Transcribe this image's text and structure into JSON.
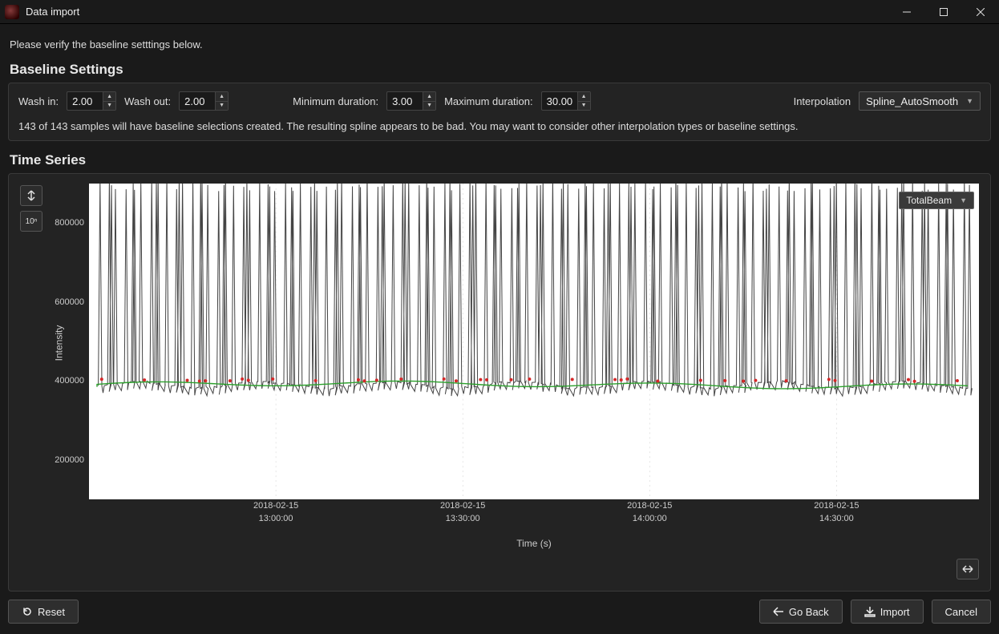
{
  "window": {
    "title": "Data import"
  },
  "instruction": "Please verify the baseline setttings below.",
  "baseline": {
    "heading": "Baseline Settings",
    "wash_in_label": "Wash in:",
    "wash_in_value": "2.00",
    "wash_out_label": "Wash out:",
    "wash_out_value": "2.00",
    "min_dur_label": "Minimum duration:",
    "min_dur_value": "3.00",
    "max_dur_label": "Maximum duration:",
    "max_dur_value": "30.00",
    "interp_label": "Interpolation",
    "interp_value": "Spline_AutoSmooth",
    "status": "143 of 143 samples will have baseline selections created. The resulting spline appears to be bad. You may want to consider other interpolation types or baseline settings."
  },
  "timeseries": {
    "heading": "Time Series",
    "ylabel": "Intensity",
    "xlabel": "Time (s)",
    "series_selected": "TotalBeam",
    "log_btn": "10ⁿ",
    "y_ticks": [
      "200000",
      "400000",
      "600000",
      "800000"
    ],
    "x_ticks": [
      {
        "pos": 0.21,
        "line1": "2018-02-15",
        "line2": "13:00:00"
      },
      {
        "pos": 0.42,
        "line1": "2018-02-15",
        "line2": "13:30:00"
      },
      {
        "pos": 0.63,
        "line1": "2018-02-15",
        "line2": "14:00:00"
      },
      {
        "pos": 0.84,
        "line1": "2018-02-15",
        "line2": "14:30:00"
      }
    ]
  },
  "chart_data": {
    "type": "line",
    "title": "",
    "xlabel": "Time (s)",
    "ylabel": "Intensity",
    "ylim": [
      100000,
      900000
    ],
    "series": [
      {
        "name": "TotalBeam",
        "description": "rapid intensity spikes to >900000 over a ~390000 baseline, ~143 peaks between 2018-02-15 12:45 and 14:45"
      },
      {
        "name": "baseline_spline",
        "description": "green spline fit near 380000–400000"
      },
      {
        "name": "markers",
        "description": "red baseline selection markers at inter-peak troughs near 400000"
      }
    ],
    "x_range": [
      "2018-02-15 12:45:00",
      "2018-02-15 14:45:00"
    ],
    "baseline_level_approx": 390000,
    "peak_count": 143,
    "peak_top_approx": 900000
  },
  "footer": {
    "reset": "Reset",
    "goback": "Go Back",
    "import": "Import",
    "cancel": "Cancel"
  }
}
